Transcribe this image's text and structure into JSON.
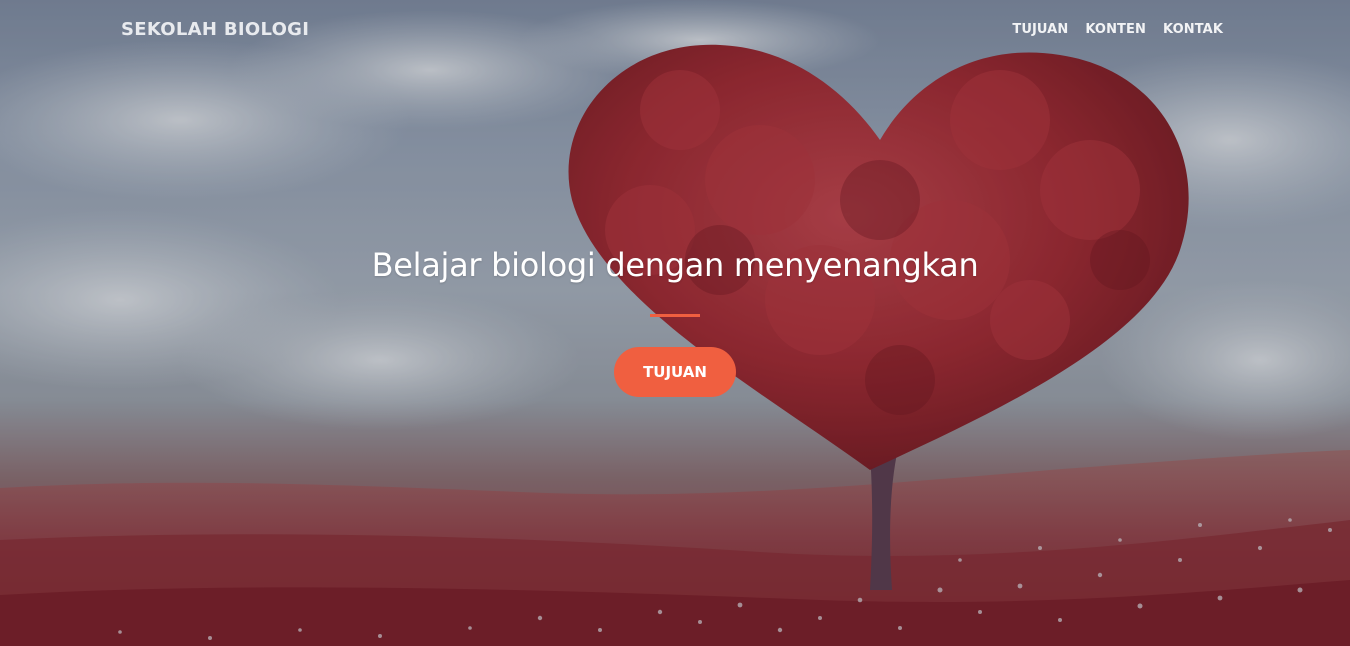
{
  "navbar": {
    "brand": "SEKOLAH BIOLOGI",
    "links": [
      "TUJUAN",
      "KONTEN",
      "KONTAK"
    ]
  },
  "hero": {
    "title": "Belajar biologi dengan menyenangkan",
    "button_label": "TUJUAN",
    "background": "heart-shaped red tree in a field of red flowers under a cloudy sky"
  },
  "colors": {
    "accent": "#f05f40",
    "text": "#ffffff"
  }
}
